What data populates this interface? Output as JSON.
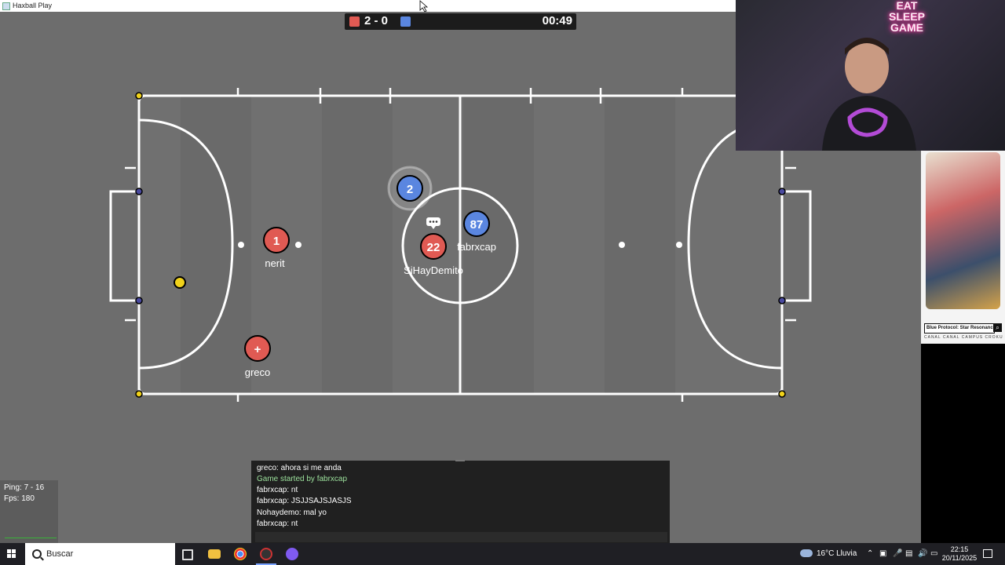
{
  "window": {
    "title": "Haxball Play"
  },
  "scoreboard": {
    "red_color": "#e05a53",
    "blue_color": "#5a86e0",
    "score": "2 - 0",
    "time": "00:49"
  },
  "players": [
    {
      "team": "red",
      "avatar": "1",
      "name": "nerit"
    },
    {
      "team": "red",
      "avatar": "+",
      "name": "greco"
    },
    {
      "team": "red",
      "avatar": "22",
      "name": "SiHayDemito"
    },
    {
      "team": "blue",
      "avatar": "87",
      "name": "fabrxcap"
    },
    {
      "team": "blue",
      "avatar": "2",
      "name": ""
    }
  ],
  "ball": {
    "color": "#f1d21a"
  },
  "webcam": {
    "neon_lines": [
      "EAT",
      "SLEEP",
      "GAME"
    ]
  },
  "ad": {
    "title": "Blue Protocol: Star Resonance",
    "subtitle": "CANAL CANAL CAMPUS CROKURA",
    "search_icon": "search-icon"
  },
  "stats": {
    "ping": "Ping: 7 - 16",
    "fps": "Fps: 180"
  },
  "chat": {
    "messages": [
      {
        "text": "greco: ahora si me anda",
        "system": false
      },
      {
        "text": "Game started by fabrxcap",
        "system": true
      },
      {
        "text": "fabrxcap: nt",
        "system": false
      },
      {
        "text": "fabrxcap: JSJJSAJSJASJS",
        "system": false
      },
      {
        "text": "Nohaydemo: mal yo",
        "system": false
      },
      {
        "text": "fabrxcap: nt",
        "system": false
      }
    ]
  },
  "taskbar": {
    "search_placeholder": "Buscar",
    "weather": "16°C  Lluvia",
    "time": "22:15",
    "date": "20/11/2025"
  }
}
